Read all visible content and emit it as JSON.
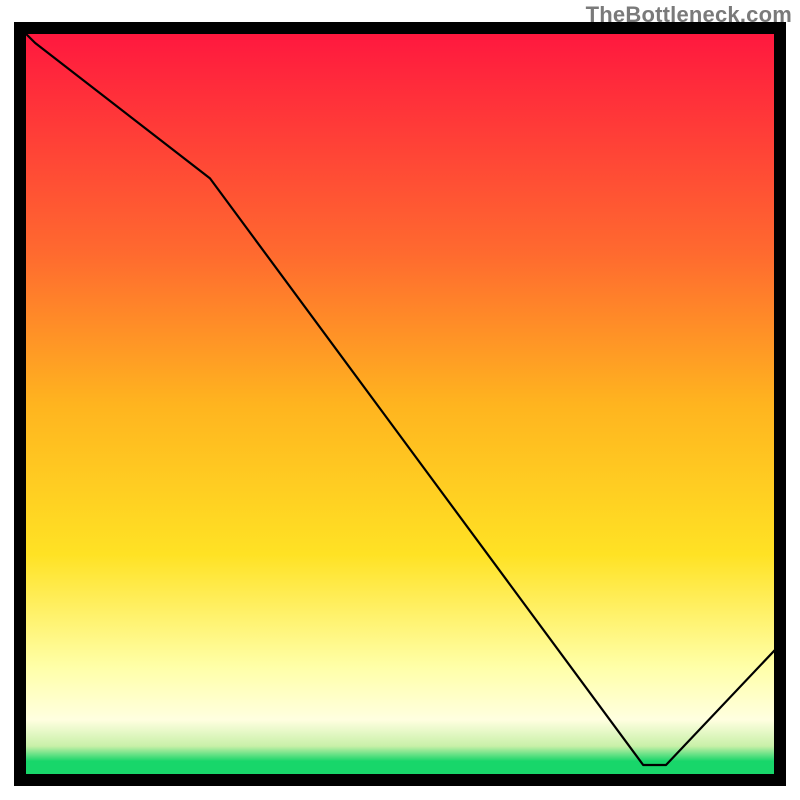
{
  "watermark": "TheBottleneck.com",
  "annotation_label": "",
  "colors": {
    "gradient_top": "#ff163f",
    "gradient_mid1": "#ff6a2f",
    "gradient_mid2": "#ffb41f",
    "gradient_mid3": "#ffe224",
    "gradient_pale": "#ffffc0",
    "gradient_green": "#18d66a",
    "line": "#000000",
    "frame": "#000000",
    "annotation": "#d9443a"
  },
  "chart_data": {
    "type": "line",
    "title": "",
    "xlabel": "",
    "ylabel": "",
    "xlim": [
      0,
      100
    ],
    "ylim": [
      0,
      100
    ],
    "x": [
      0,
      2,
      25,
      82,
      85,
      100
    ],
    "values": [
      100,
      98,
      80,
      2,
      2,
      18
    ],
    "annotation": {
      "text": "",
      "x_start": 73,
      "x_end": 86,
      "y": 2.5
    },
    "background_gradient_stops": [
      {
        "offset": 0.0,
        "color": "#ff163f"
      },
      {
        "offset": 0.3,
        "color": "#ff6a2f"
      },
      {
        "offset": 0.5,
        "color": "#ffb41f"
      },
      {
        "offset": 0.7,
        "color": "#ffe224"
      },
      {
        "offset": 0.85,
        "color": "#ffffa8"
      },
      {
        "offset": 0.92,
        "color": "#ffffe0"
      },
      {
        "offset": 0.955,
        "color": "#c8f0a8"
      },
      {
        "offset": 0.975,
        "color": "#18d66a"
      },
      {
        "offset": 1.0,
        "color": "#18d66a"
      }
    ]
  }
}
